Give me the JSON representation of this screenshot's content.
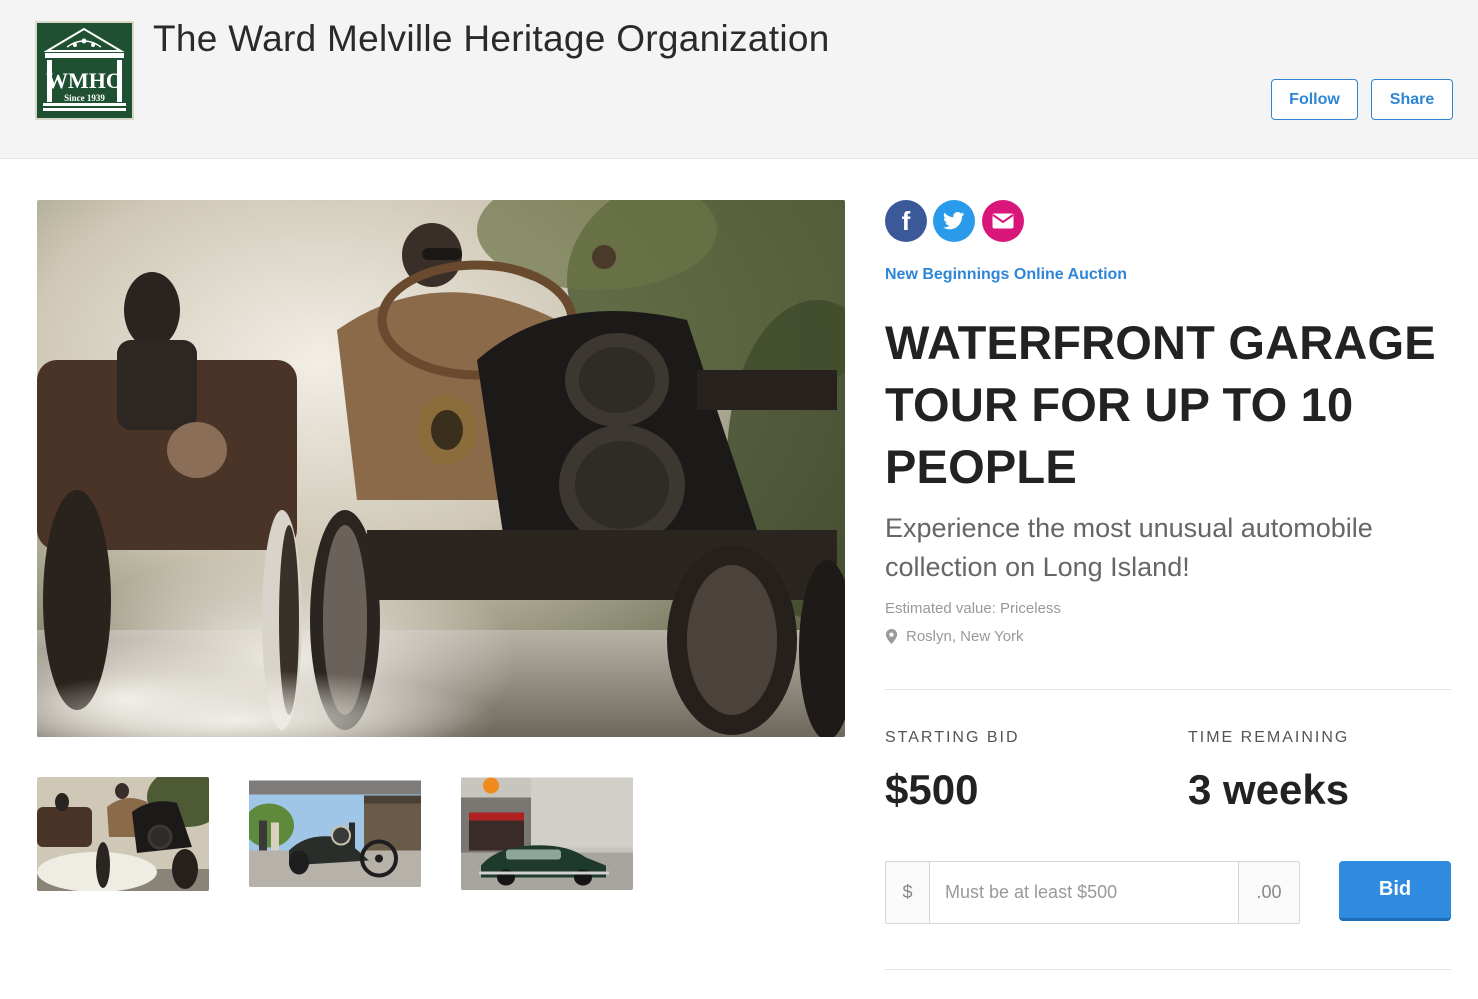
{
  "header": {
    "logo_text": "WMHO",
    "logo_since": "Since 1939",
    "org_name": "The Ward Melville Heritage Organization",
    "follow_label": "Follow",
    "share_label": "Share"
  },
  "social": {
    "facebook_glyph": "f",
    "icons": [
      "facebook-icon",
      "twitter-icon",
      "email-icon"
    ],
    "colors": {
      "facebook": "#3b5998",
      "twitter": "#2a9bea",
      "email": "#d9177b"
    }
  },
  "item": {
    "auction_name": "New Beginnings Online Auction",
    "title_line1": "WATERFRONT GARAGE",
    "title_line2": "TOUR FOR UP TO 10",
    "title_line3": "PEOPLE",
    "description": "Experience the most unusual automobile collection on Long Island!",
    "estimated_value": "Estimated value: Priceless",
    "location": "Roslyn, New York"
  },
  "bidding": {
    "starting_bid_label": "STARTING BID",
    "starting_bid_value": "$500",
    "time_remaining_label": "TIME REMAINING",
    "time_remaining_value": "3 weeks",
    "currency_prefix": "$",
    "cents_suffix": ".00",
    "input_placeholder": "Must be at least $500",
    "bid_button_label": "Bid"
  },
  "gallery": {
    "thumbnails": [
      "vintage-race-car-thumbnail",
      "car-show-thumbnail",
      "classic-car-gulf-station-thumbnail"
    ]
  },
  "colors": {
    "accent": "#2f86d6",
    "header_bg": "#f4f4f4",
    "logo_bg": "#1f5032"
  }
}
